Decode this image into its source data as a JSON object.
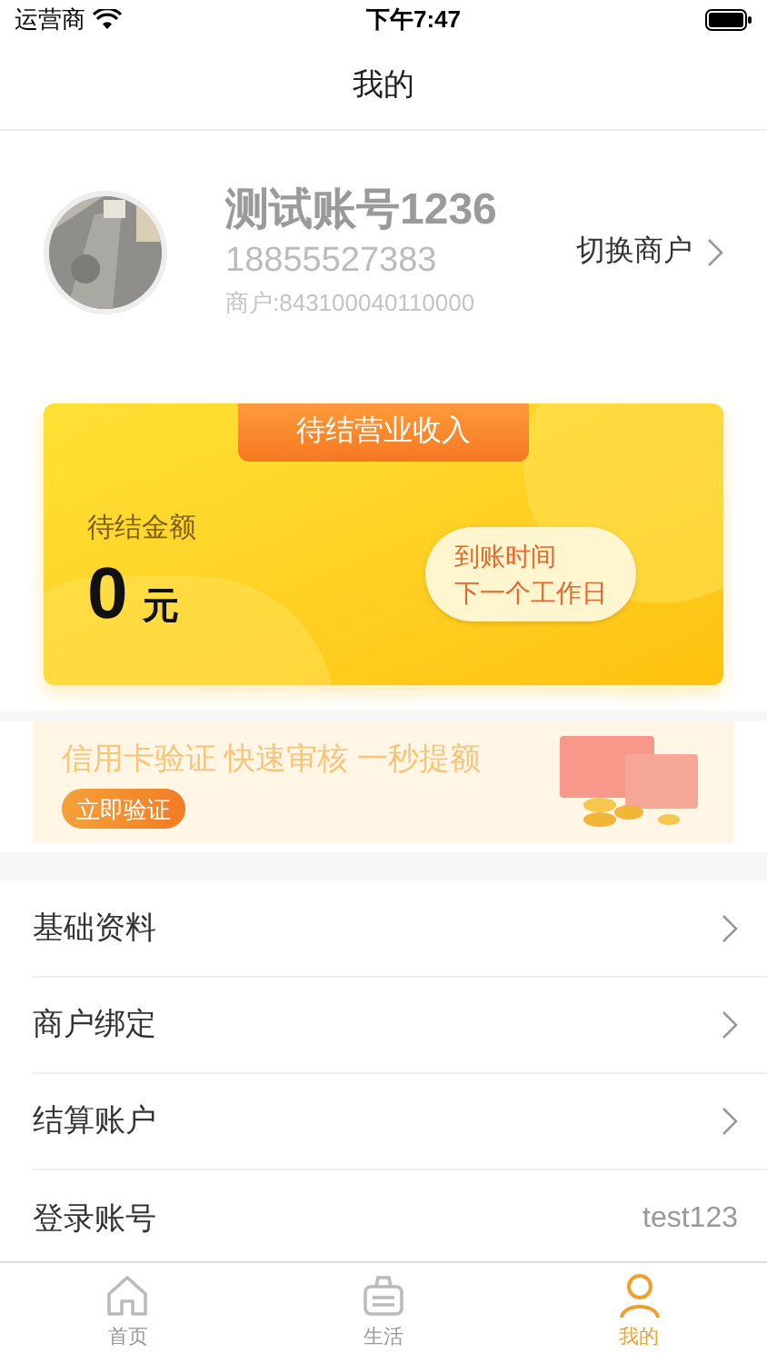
{
  "status_bar": {
    "carrier": "运营商",
    "time": "下午7:47"
  },
  "nav": {
    "title": "我的"
  },
  "profile": {
    "name": "测试账号1236",
    "phone": "18855527383",
    "merchant": "商户:843100040110000",
    "switch_label": "切换商户"
  },
  "income_card": {
    "title": "待结营业收入",
    "amount_label": "待结金额",
    "amount": "0",
    "unit": "元",
    "arrival_label": "到账时间",
    "arrival_value": "下一个工作日"
  },
  "banner": {
    "text": "信用卡验证 快速审核 一秒提额",
    "button": "立即验证"
  },
  "menu": [
    {
      "label": "基础资料",
      "kind": "link"
    },
    {
      "label": "商户绑定",
      "kind": "link"
    },
    {
      "label": "结算账户",
      "kind": "link"
    },
    {
      "label": "登录账号",
      "kind": "value",
      "value": "test123"
    }
  ],
  "tab_bar": [
    {
      "label": "首页",
      "kind": "home",
      "selected": false
    },
    {
      "label": "生活",
      "kind": "basket",
      "selected": false
    },
    {
      "label": "我的",
      "kind": "user",
      "selected": true
    }
  ]
}
